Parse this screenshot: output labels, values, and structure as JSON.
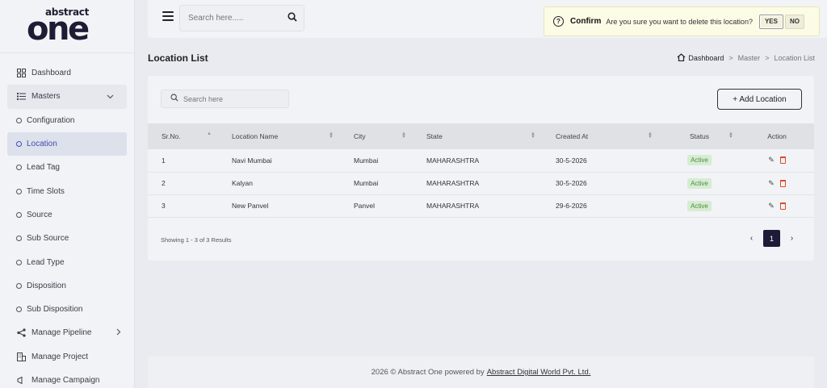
{
  "brand": {
    "small": "abstract",
    "big": "one"
  },
  "sidebar": {
    "items": [
      {
        "label": "Dashboard",
        "icon": "grid-icon"
      },
      {
        "label": "Masters",
        "icon": "list-icon"
      },
      {
        "label": "Configuration"
      },
      {
        "label": "Location"
      },
      {
        "label": "Lead Tag"
      },
      {
        "label": "Time Slots"
      },
      {
        "label": "Source"
      },
      {
        "label": "Sub Source"
      },
      {
        "label": "Lead Type"
      },
      {
        "label": "Disposition"
      },
      {
        "label": "Sub Disposition"
      },
      {
        "label": "Manage Pipeline",
        "icon": "share-icon"
      },
      {
        "label": "Manage Project",
        "icon": "building-icon"
      },
      {
        "label": "Manage Campaign",
        "icon": "megaphone-icon"
      }
    ]
  },
  "topbar": {
    "search_placeholder": "Search here....."
  },
  "confirm": {
    "title": "Confirm",
    "message": "Are you sure you want to delete this location?",
    "yes": "YES",
    "no": "NO"
  },
  "page": {
    "title": "Location List",
    "breadcrumb": [
      "Dashboard",
      ">",
      "Master",
      ">",
      "Location List"
    ]
  },
  "list": {
    "search_placeholder": "Search here",
    "add_label": "+ Add Location",
    "columns": [
      "Sr.No.",
      "Location Name",
      "City",
      "State",
      "Created At",
      "Status",
      "Action"
    ],
    "rows": [
      {
        "sr": "1",
        "name": "Navi Mumbai",
        "city": "Mumbai",
        "state": "MAHARASHTRA",
        "created": "30-5-2026",
        "status": "Active"
      },
      {
        "sr": "2",
        "name": "Kalyan",
        "city": "Mumbai",
        "state": "MAHARASHTRA",
        "created": "30-5-2026",
        "status": "Active"
      },
      {
        "sr": "3",
        "name": "New Panvel",
        "city": "Panvel",
        "state": "MAHARASHTRA",
        "created": "29-6-2026",
        "status": "Active"
      }
    ],
    "showing": "Showing 1 - 3 of 3 Results",
    "pager": {
      "prev": "‹",
      "current": "1",
      "next": "›"
    }
  },
  "footer": {
    "text": "2026 © Abstract One powered by",
    "link": "Abstract Digital World Pvt. Ltd."
  },
  "colors": {
    "accent": "#3e4ea8",
    "active_badge": "#4a8f3e",
    "delete": "#d94d2a",
    "dark": "#1c1c38"
  }
}
